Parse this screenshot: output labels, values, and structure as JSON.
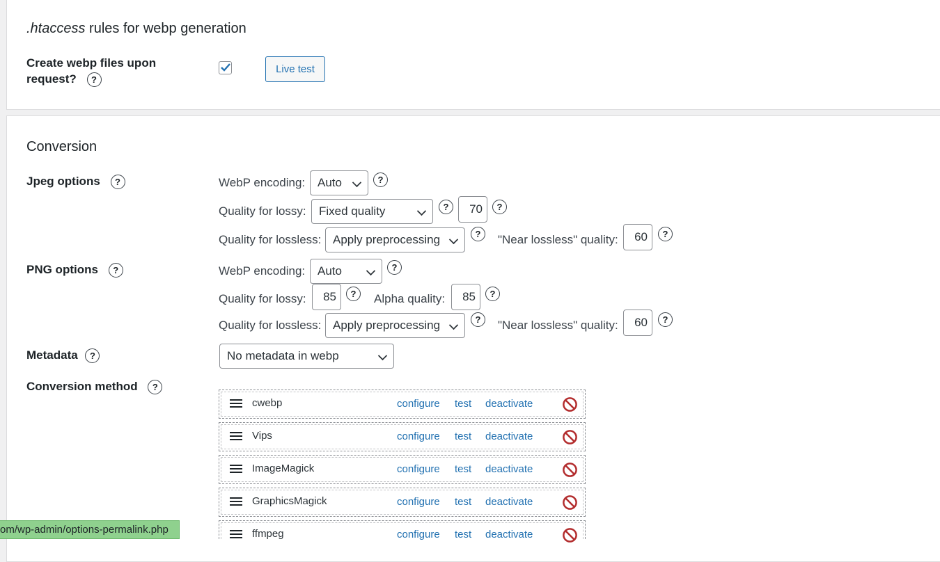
{
  "htaccess": {
    "title_italic": ".htaccess",
    "title_rest": " rules for webp generation",
    "create_label_line1": "Create webp files upon",
    "create_label_line2": "request?",
    "help": "?",
    "checked": true,
    "live_test_label": "Live test"
  },
  "conversion": {
    "title": "Conversion",
    "jpeg": {
      "label": "Jpeg options",
      "encoding_label": "WebP encoding:",
      "encoding_value": "Auto",
      "lossy_label": "Quality for lossy:",
      "lossy_value": "Fixed quality",
      "lossy_quality": "70",
      "lossless_label": "Quality for lossless:",
      "lossless_value": "Apply preprocessing",
      "near_lossless_label": "\"Near lossless\" quality:",
      "near_lossless_value": "60"
    },
    "png": {
      "label": "PNG options",
      "encoding_label": "WebP encoding:",
      "encoding_value": "Auto",
      "lossy_label": "Quality for lossy:",
      "lossy_value": "85",
      "alpha_label": "Alpha quality:",
      "alpha_value": "85",
      "lossless_label": "Quality for lossless:",
      "lossless_value": "Apply preprocessing",
      "near_lossless_label": "\"Near lossless\" quality:",
      "near_lossless_value": "60"
    },
    "metadata": {
      "label": "Metadata",
      "value": "No metadata in webp"
    },
    "method": {
      "label": "Conversion method",
      "converters": [
        {
          "name": "cwebp",
          "configure": "configure",
          "test": "test",
          "deactivate": "deactivate"
        },
        {
          "name": "Vips",
          "configure": "configure",
          "test": "test",
          "deactivate": "deactivate"
        },
        {
          "name": "ImageMagick",
          "configure": "configure",
          "test": "test",
          "deactivate": "deactivate"
        },
        {
          "name": "GraphicsMagick",
          "configure": "configure",
          "test": "test",
          "deactivate": "deactivate"
        },
        {
          "name": "ffmpeg",
          "configure": "configure",
          "test": "test",
          "deactivate": "deactivate"
        }
      ]
    }
  },
  "status_bar": {
    "url": "om/wp-admin/options-permalink.php"
  },
  "colors": {
    "link": "#2271b1",
    "status_bar": "#8fd18e",
    "deactivate_icon": "#b32d2e"
  }
}
